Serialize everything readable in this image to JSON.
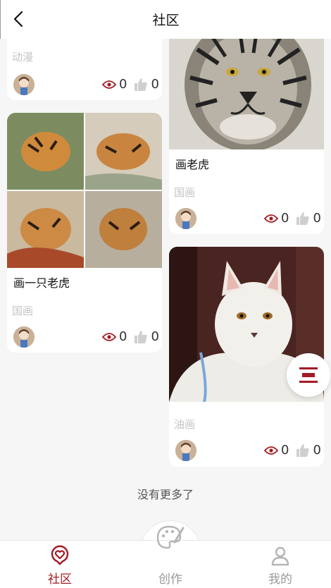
{
  "header": {
    "title": "社区"
  },
  "cards": [
    {
      "tag": "动漫",
      "views": "0",
      "likes": "0"
    },
    {
      "caption": "画老虎",
      "tag": "国画",
      "views": "0",
      "likes": "0"
    },
    {
      "caption": "画一只老虎",
      "tag": "国画",
      "views": "0",
      "likes": "0"
    },
    {
      "tag": "油画",
      "views": "0",
      "likes": "0"
    }
  ],
  "footer_note": "没有更多了",
  "tabs": [
    {
      "label": "社区",
      "active": true
    },
    {
      "label": "创作",
      "active": false
    },
    {
      "label": "我的",
      "active": false
    }
  ],
  "colors": {
    "accent": "#a31c25",
    "inactive": "#999999"
  }
}
